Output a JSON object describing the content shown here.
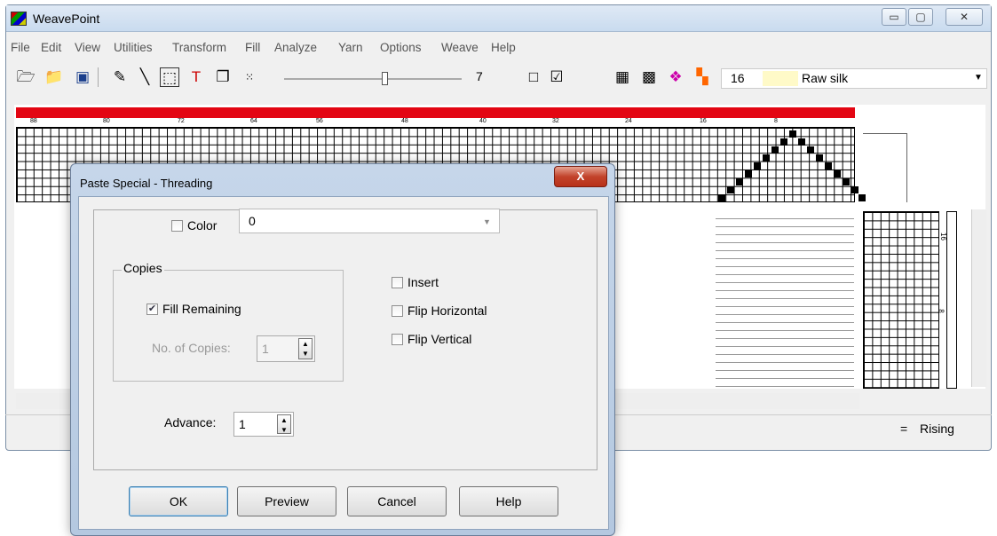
{
  "window": {
    "title": "WeavePoint",
    "minimize": "▭",
    "maximize": "▢",
    "close": "✕"
  },
  "menus": [
    "File",
    "Edit",
    "View",
    "Utilities",
    "Transform",
    "Fill",
    "Analyze",
    "Yarn",
    "Options",
    "Weave",
    "Help"
  ],
  "toolbar": {
    "slider_value": "7",
    "color_number": "16",
    "yarn_name": "Raw silk"
  },
  "ruler": [
    "88",
    "80",
    "72",
    "64",
    "56",
    "48",
    "40",
    "32",
    "24",
    "16",
    "8"
  ],
  "tieup_labels": [
    "16",
    "8"
  ],
  "status": {
    "symbol": "=",
    "mode": "Rising"
  },
  "colors": {
    "redbar": "#e30613",
    "dialog_close": "#c2432b"
  },
  "dialog": {
    "title": "Paste Special - Threading",
    "close": "X",
    "color_label": "Color",
    "color_value": "0",
    "copies_label": "Copies",
    "fill_remaining": "Fill Remaining",
    "copies_count_label": "No. of Copies:",
    "copies_count": "1",
    "insert": "Insert",
    "flip_h": "Flip Horizontal",
    "flip_v": "Flip Vertical",
    "advance_label": "Advance:",
    "advance_value": "1",
    "ok": "OK",
    "preview": "Preview",
    "cancel": "Cancel",
    "help": "Help"
  }
}
